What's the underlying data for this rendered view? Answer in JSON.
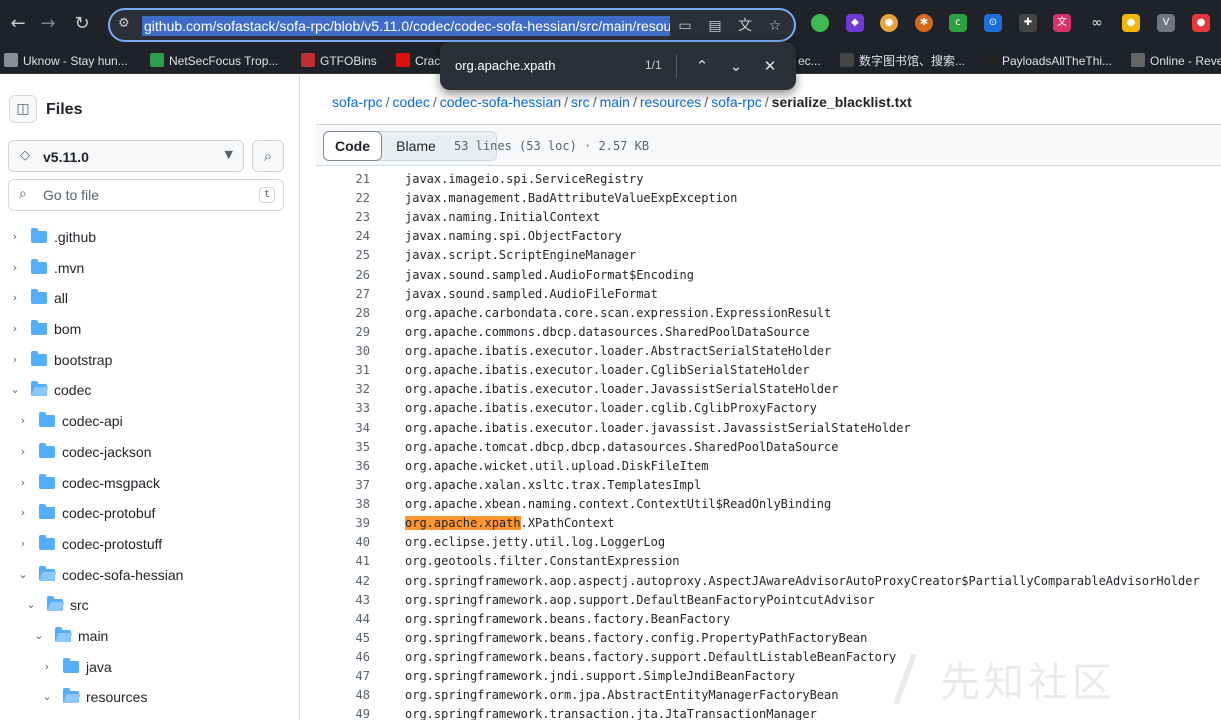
{
  "browser": {
    "url": "github.com/sofastack/sofa-rpc/blob/v5.11.0/codec/codec-sofa-hessian/src/main/resources/sofa-rpc/serialize_blacklist.txt",
    "bookmarks": [
      {
        "label": "Uknow - Stay hun...",
        "color": "#8a8f96"
      },
      {
        "label": "NetSecFocus Trop...",
        "color": "#2e9e4f"
      },
      {
        "label": "GTFOBins",
        "color": "#c02f2f"
      },
      {
        "label": "Crac",
        "color": "#d11"
      },
      {
        "label": "ec...",
        "color": "#555"
      },
      {
        "label": "数字图书馆、搜索...",
        "color": "#444"
      },
      {
        "label": "PayloadsAllTheThi...",
        "color": "#222"
      },
      {
        "label": "Online - Reve",
        "color": "#666"
      }
    ]
  },
  "find": {
    "query": "org.apache.xpath",
    "count": "1/1"
  },
  "sidebar": {
    "title": "Files",
    "branch": "v5.11.0",
    "goto_placeholder": "Go to file",
    "goto_shortcut": "t",
    "tree": [
      {
        "label": ".github",
        "depth": 0,
        "open": false
      },
      {
        "label": ".mvn",
        "depth": 0,
        "open": false
      },
      {
        "label": "all",
        "depth": 0,
        "open": false
      },
      {
        "label": "bom",
        "depth": 0,
        "open": false
      },
      {
        "label": "bootstrap",
        "depth": 0,
        "open": false
      },
      {
        "label": "codec",
        "depth": 0,
        "open": true
      },
      {
        "label": "codec-api",
        "depth": 1,
        "open": false
      },
      {
        "label": "codec-jackson",
        "depth": 1,
        "open": false
      },
      {
        "label": "codec-msgpack",
        "depth": 1,
        "open": false
      },
      {
        "label": "codec-protobuf",
        "depth": 1,
        "open": false
      },
      {
        "label": "codec-protostuff",
        "depth": 1,
        "open": false
      },
      {
        "label": "codec-sofa-hessian",
        "depth": 1,
        "open": true
      },
      {
        "label": "src",
        "depth": 2,
        "open": true
      },
      {
        "label": "main",
        "depth": 3,
        "open": true
      },
      {
        "label": "java",
        "depth": 4,
        "open": false
      },
      {
        "label": "resources",
        "depth": 4,
        "open": true
      }
    ]
  },
  "breadcrumb": {
    "parts": [
      "sofa-rpc",
      "codec",
      "codec-sofa-hessian",
      "src",
      "main",
      "resources",
      "sofa-rpc"
    ],
    "file": "serialize_blacklist.txt"
  },
  "filebar": {
    "code_tab": "Code",
    "blame_tab": "Blame",
    "meta": "53 lines (53 loc) · 2.57 KB"
  },
  "code": {
    "lines": [
      {
        "n": "21",
        "text": "javax.imageio.spi.ServiceRegistry"
      },
      {
        "n": "22",
        "text": "javax.management.BadAttributeValueExpException"
      },
      {
        "n": "23",
        "text": "javax.naming.InitialContext"
      },
      {
        "n": "24",
        "text": "javax.naming.spi.ObjectFactory"
      },
      {
        "n": "25",
        "text": "javax.script.ScriptEngineManager"
      },
      {
        "n": "26",
        "text": "javax.sound.sampled.AudioFormat$Encoding"
      },
      {
        "n": "27",
        "text": "javax.sound.sampled.AudioFileFormat"
      },
      {
        "n": "28",
        "text": "org.apache.carbondata.core.scan.expression.ExpressionResult"
      },
      {
        "n": "29",
        "text": "org.apache.commons.dbcp.datasources.SharedPoolDataSource"
      },
      {
        "n": "30",
        "text": "org.apache.ibatis.executor.loader.AbstractSerialStateHolder"
      },
      {
        "n": "31",
        "text": "org.apache.ibatis.executor.loader.CglibSerialStateHolder"
      },
      {
        "n": "32",
        "text": "org.apache.ibatis.executor.loader.JavassistSerialStateHolder"
      },
      {
        "n": "33",
        "text": "org.apache.ibatis.executor.loader.cglib.CglibProxyFactory"
      },
      {
        "n": "34",
        "text": "org.apache.ibatis.executor.loader.javassist.JavassistSerialStateHolder"
      },
      {
        "n": "35",
        "text": "org.apache.tomcat.dbcp.dbcp.datasources.SharedPoolDataSource"
      },
      {
        "n": "36",
        "text": "org.apache.wicket.util.upload.DiskFileItem"
      },
      {
        "n": "37",
        "text": "org.apache.xalan.xsltc.trax.TemplatesImpl"
      },
      {
        "n": "38",
        "text": "org.apache.xbean.naming.context.ContextUtil$ReadOnlyBinding"
      },
      {
        "n": "39",
        "text": ".XPathContext",
        "match": "org.apache.xpath"
      },
      {
        "n": "40",
        "text": "org.eclipse.jetty.util.log.LoggerLog"
      },
      {
        "n": "41",
        "text": "org.geotools.filter.ConstantExpression"
      },
      {
        "n": "42",
        "text": "org.springframework.aop.aspectj.autoproxy.AspectJAwareAdvisorAutoProxyCreator$PartiallyComparableAdvisorHolder"
      },
      {
        "n": "43",
        "text": "org.springframework.aop.support.DefaultBeanFactoryPointcutAdvisor"
      },
      {
        "n": "44",
        "text": "org.springframework.beans.factory.BeanFactory"
      },
      {
        "n": "45",
        "text": "org.springframework.beans.factory.config.PropertyPathFactoryBean"
      },
      {
        "n": "46",
        "text": "org.springframework.beans.factory.support.DefaultListableBeanFactory"
      },
      {
        "n": "47",
        "text": "org.springframework.jndi.support.SimpleJndiBeanFactory"
      },
      {
        "n": "48",
        "text": "org.springframework.orm.jpa.AbstractEntityManagerFactoryBean"
      },
      {
        "n": "49",
        "text": "org.springframework.transaction.jta.JtaTransactionManager"
      }
    ]
  },
  "watermark": "先知社区"
}
